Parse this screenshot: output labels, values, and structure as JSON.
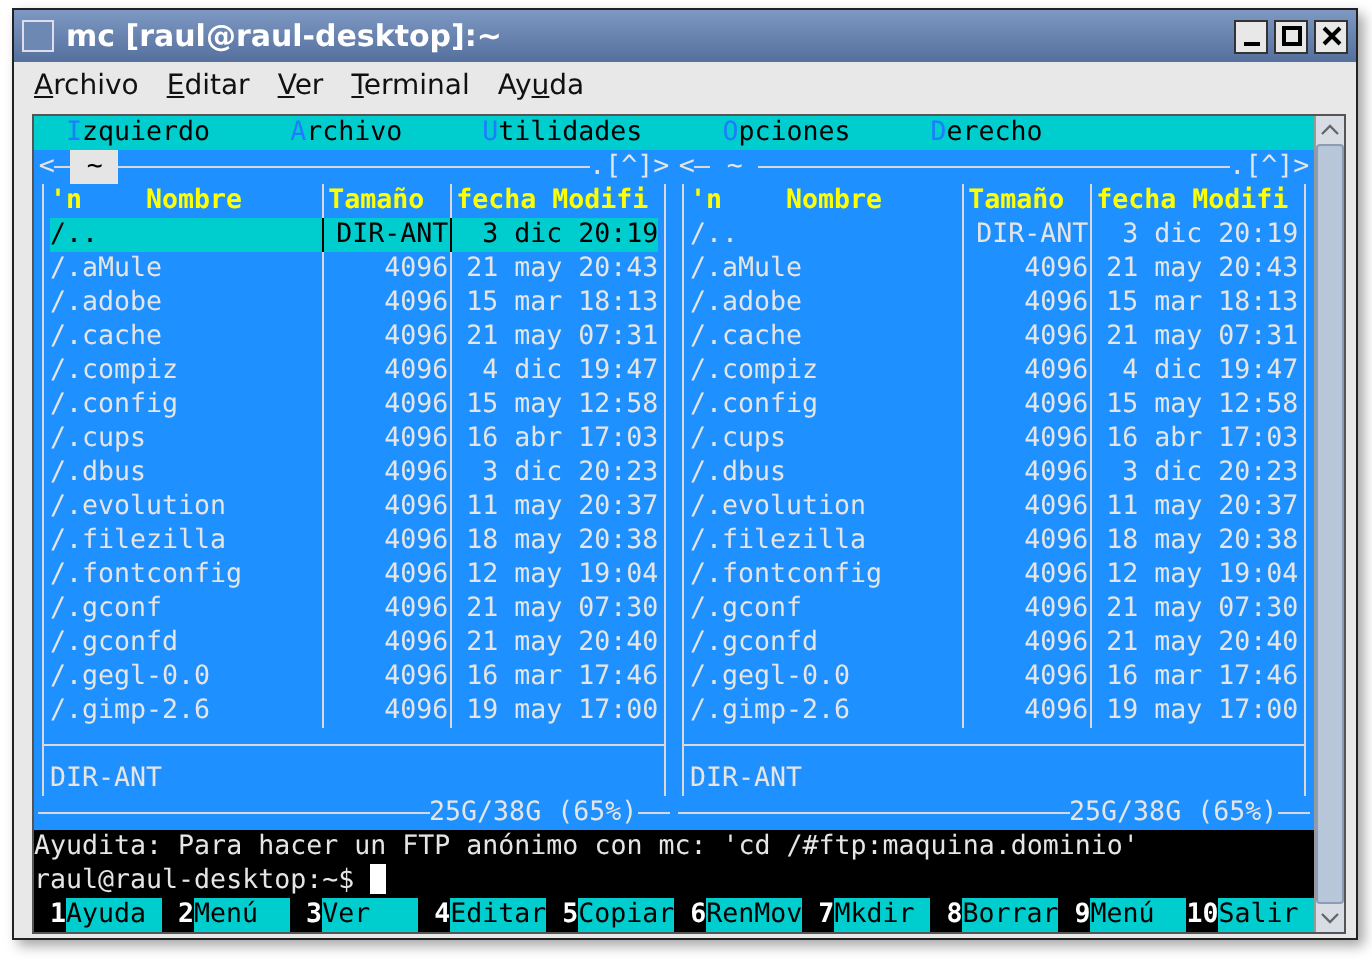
{
  "window": {
    "title": "mc [raul@raul-desktop]:~"
  },
  "menubar": [
    {
      "key": "A",
      "post": "rchivo"
    },
    {
      "key": "E",
      "post": "ditar"
    },
    {
      "key": "V",
      "post": "er"
    },
    {
      "key": "T",
      "post": "erminal"
    },
    {
      "pre": "Ay",
      "key": "u",
      "post": "da"
    }
  ],
  "mc_menu": [
    {
      "key": "I",
      "post": "zquierdo"
    },
    {
      "key": "A",
      "post": "rchivo"
    },
    {
      "key": "U",
      "post": "tilidades"
    },
    {
      "key": "O",
      "post": "pciones"
    },
    {
      "key": "D",
      "post": "erecho"
    }
  ],
  "panels": [
    {
      "active": true,
      "left_mark": "<",
      "path": "~",
      "right_mark": ".[^]>",
      "header": {
        "sort": "'n",
        "name": "Nombre",
        "size": "Tamaño",
        "date": "fecha Modifi"
      },
      "rows": [
        {
          "name": "/..",
          "size": "DIR-ANT",
          "date": "3 dic 20:19",
          "selected": true
        },
        {
          "name": "/.aMule",
          "size": "4096",
          "date": "21 may 20:43",
          "selected": false
        },
        {
          "name": "/.adobe",
          "size": "4096",
          "date": "15 mar 18:13",
          "selected": false
        },
        {
          "name": "/.cache",
          "size": "4096",
          "date": "21 may 07:31",
          "selected": false
        },
        {
          "name": "/.compiz",
          "size": "4096",
          "date": "4 dic 19:47",
          "selected": false
        },
        {
          "name": "/.config",
          "size": "4096",
          "date": "15 may 12:58",
          "selected": false
        },
        {
          "name": "/.cups",
          "size": "4096",
          "date": "16 abr 17:03",
          "selected": false
        },
        {
          "name": "/.dbus",
          "size": "4096",
          "date": "3 dic 20:23",
          "selected": false
        },
        {
          "name": "/.evolution",
          "size": "4096",
          "date": "11 may 20:37",
          "selected": false
        },
        {
          "name": "/.filezilla",
          "size": "4096",
          "date": "18 may 20:38",
          "selected": false
        },
        {
          "name": "/.fontconfig",
          "size": "4096",
          "date": "12 may 19:04",
          "selected": false
        },
        {
          "name": "/.gconf",
          "size": "4096",
          "date": "21 may 07:30",
          "selected": false
        },
        {
          "name": "/.gconfd",
          "size": "4096",
          "date": "21 may 20:40",
          "selected": false
        },
        {
          "name": "/.gegl-0.0",
          "size": "4096",
          "date": "16 mar 17:46",
          "selected": false
        },
        {
          "name": "/.gimp-2.6",
          "size": "4096",
          "date": "19 may 17:00",
          "selected": false
        }
      ],
      "mini_status": "DIR-ANT",
      "disk": "25G/38G (65%)"
    },
    {
      "active": false,
      "left_mark": "<",
      "path": "~",
      "right_mark": ".[^]>",
      "header": {
        "sort": "'n",
        "name": "Nombre",
        "size": "Tamaño",
        "date": "fecha Modifi"
      },
      "rows": [
        {
          "name": "/..",
          "size": "DIR-ANT",
          "date": "3 dic 20:19"
        },
        {
          "name": "/.aMule",
          "size": "4096",
          "date": "21 may 20:43"
        },
        {
          "name": "/.adobe",
          "size": "4096",
          "date": "15 mar 18:13"
        },
        {
          "name": "/.cache",
          "size": "4096",
          "date": "21 may 07:31"
        },
        {
          "name": "/.compiz",
          "size": "4096",
          "date": "4 dic 19:47"
        },
        {
          "name": "/.config",
          "size": "4096",
          "date": "15 may 12:58"
        },
        {
          "name": "/.cups",
          "size": "4096",
          "date": "16 abr 17:03"
        },
        {
          "name": "/.dbus",
          "size": "4096",
          "date": "3 dic 20:23"
        },
        {
          "name": "/.evolution",
          "size": "4096",
          "date": "11 may 20:37"
        },
        {
          "name": "/.filezilla",
          "size": "4096",
          "date": "18 may 20:38"
        },
        {
          "name": "/.fontconfig",
          "size": "4096",
          "date": "12 may 19:04"
        },
        {
          "name": "/.gconf",
          "size": "4096",
          "date": "21 may 07:30"
        },
        {
          "name": "/.gconfd",
          "size": "4096",
          "date": "21 may 20:40"
        },
        {
          "name": "/.gegl-0.0",
          "size": "4096",
          "date": "16 mar 17:46"
        },
        {
          "name": "/.gimp-2.6",
          "size": "4096",
          "date": "19 may 17:00"
        }
      ],
      "mini_status": "DIR-ANT",
      "disk": "25G/38G (65%)"
    }
  ],
  "hint": "Ayudita: Para hacer un FTP anónimo con mc: 'cd /#ftp:maquina.dominio'",
  "prompt": "raul@raul-desktop:~$",
  "function_keys": [
    {
      "num": "1",
      "label": "Ayuda"
    },
    {
      "num": "2",
      "label": "Menú"
    },
    {
      "num": "3",
      "label": "Ver"
    },
    {
      "num": "4",
      "label": "Editar"
    },
    {
      "num": "5",
      "label": "Copiar"
    },
    {
      "num": "6",
      "label": "RenMov"
    },
    {
      "num": "7",
      "label": "Mkdir"
    },
    {
      "num": "8",
      "label": "Borrar"
    },
    {
      "num": "9",
      "label": "Menú"
    },
    {
      "num": "10",
      "label": "Salir"
    }
  ]
}
